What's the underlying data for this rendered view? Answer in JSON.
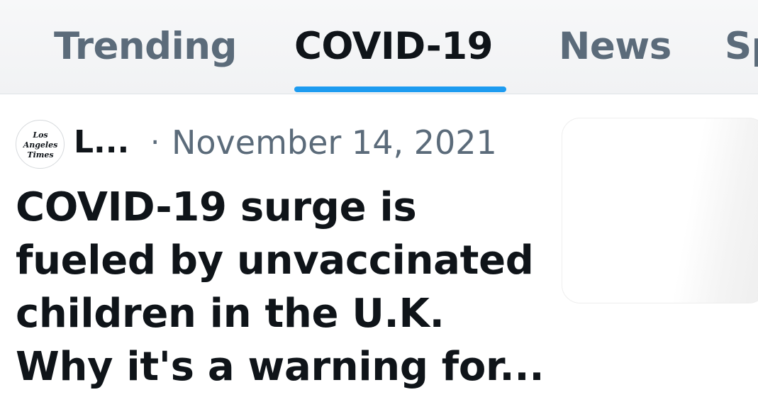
{
  "tabs": [
    {
      "label": "Trending",
      "active": false
    },
    {
      "label": "COVID-19",
      "active": true
    },
    {
      "label": "News",
      "active": false
    },
    {
      "label": "Sp",
      "active": false
    }
  ],
  "colors": {
    "accent": "#1d9bf0",
    "text_primary": "#0f1419",
    "text_secondary": "#5b6b7a"
  },
  "article": {
    "avatar_icon": "los-angeles-times-logo",
    "avatar_logo_text": [
      "Los",
      "Angeles",
      "Times"
    ],
    "source_name": "L...",
    "separator": "·",
    "date": "November 14, 2021",
    "headline_lines": [
      "COVID-19 surge is",
      "fueled by unvaccinated",
      "children in the U.K.",
      "Why it's a warning for..."
    ]
  }
}
